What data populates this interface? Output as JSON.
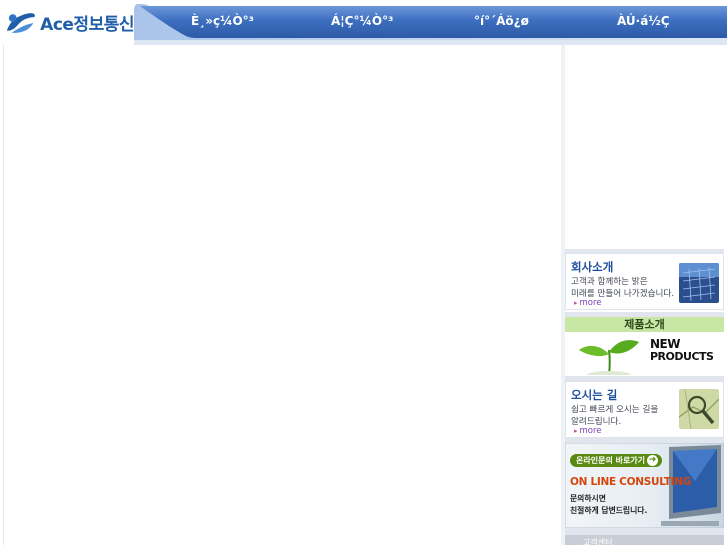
{
  "header": {
    "logo_text": "Ace정보통신",
    "nav": [
      {
        "label": "È¸»ç¼Ò°³"
      },
      {
        "label": "Á¦Ç°¼Ò°³"
      },
      {
        "label": "°í°´Áö¿ø"
      },
      {
        "label": "ÀÚ·á½Ç"
      }
    ]
  },
  "sidebar": {
    "company": {
      "title": "회사소개",
      "line1": "고객과 함께하는 밝은",
      "line2": "미래를 만들어 나가겠습니다.",
      "more": "more"
    },
    "products": {
      "title": "제품소개",
      "line1": "NEW",
      "line2": "PRODUCTS"
    },
    "location": {
      "title": "오시는 길",
      "line1": "쉽고 빠르게 오시는 길을",
      "line2": "알려드립니다.",
      "more": "more"
    },
    "consulting": {
      "pill": "온라인문의 바로가기",
      "title": "ON LINE CONSULTING",
      "line1": "문의하시면",
      "line2": "친절하게 답변드립니다."
    },
    "support": {
      "title": "고객센터"
    }
  },
  "colors": {
    "nav_blue": "#3d6fc0",
    "brand_blue": "#1f5ea8",
    "more_purple": "#7b3fb6",
    "consult_orange": "#d4450b",
    "product_green": "#c8e6a4"
  },
  "icons": {
    "logo_mark": "ace-logo-icon",
    "company_thumb": "solar-panel-icon",
    "location_thumb": "map-magnifier-icon",
    "products_art": "sprout-icon",
    "consulting_art": "computer-monitor-icon"
  }
}
